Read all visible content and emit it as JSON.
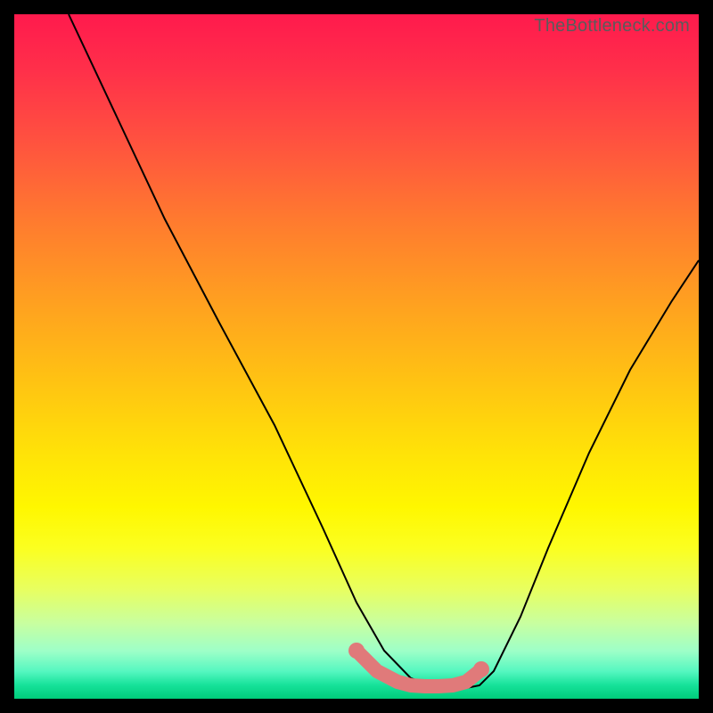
{
  "watermark": "TheBottleneck.com",
  "chart_data": {
    "type": "line",
    "title": "",
    "xlabel": "",
    "ylabel": "",
    "xlim": [
      0,
      100
    ],
    "ylim": [
      0,
      100
    ],
    "grid": false,
    "legend": false,
    "series": [
      {
        "name": "bottleneck-curve",
        "x": [
          8,
          15,
          22,
          30,
          38,
          45,
          50,
          54,
          58,
          62,
          66,
          68,
          70,
          74,
          78,
          84,
          90,
          96,
          100
        ],
        "y": [
          100,
          85,
          70,
          55,
          40,
          25,
          14,
          7,
          3,
          1.5,
          1.5,
          2,
          4,
          12,
          22,
          36,
          48,
          58,
          64
        ]
      }
    ],
    "highlight": {
      "name": "pink-region",
      "x": [
        50,
        53,
        56,
        58,
        60,
        62,
        64,
        66,
        68
      ],
      "y": [
        7,
        4,
        2.5,
        2,
        1.8,
        1.8,
        2,
        2.5,
        4
      ]
    },
    "background_gradient": {
      "top": "#ff1a4d",
      "mid": "#fff700",
      "bottom": "#00cc7a"
    }
  }
}
